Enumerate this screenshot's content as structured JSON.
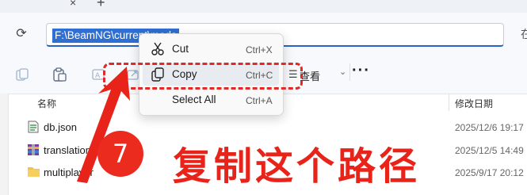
{
  "tabs": {
    "close_glyph": "×",
    "new_tab_glyph": "+"
  },
  "address": {
    "refresh_glyph": "⟳",
    "value": "F:\\BeamNG\\current\\mods",
    "search_glyph": "在"
  },
  "toolbar": {
    "view_label": "查看",
    "view_glyph": "☰",
    "chevron": "⌄",
    "more_label": "···"
  },
  "list": {
    "col_name": "名称",
    "col_date": "修改日期",
    "rows": [
      {
        "name": "db.json",
        "date": "2025/12/6 19:17"
      },
      {
        "name": "translations",
        "date": "2025/12/5 14:49"
      },
      {
        "name": "multiplayer",
        "date": "2025/9/17 20:12"
      }
    ]
  },
  "context_menu": {
    "items": [
      {
        "label": "Cut",
        "shortcut": "Ctrl+X",
        "icon": "scissors-icon"
      },
      {
        "label": "Copy",
        "shortcut": "Ctrl+C",
        "icon": "copy-icon"
      },
      {
        "label": "Select All",
        "shortcut": "Ctrl+A",
        "icon": ""
      }
    ]
  },
  "annotation": {
    "step": "7",
    "text": "复制这个路径",
    "color": "#e8231a"
  }
}
